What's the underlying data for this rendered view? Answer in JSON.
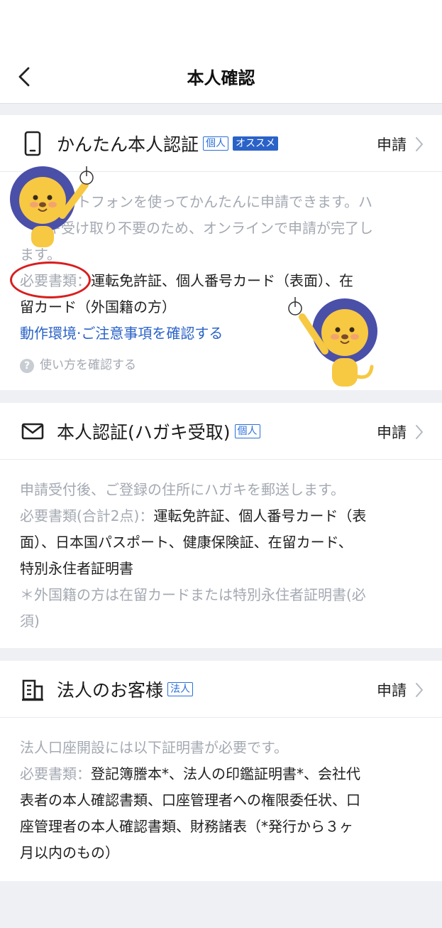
{
  "header": {
    "title": "本人確認"
  },
  "cards": {
    "easy": {
      "title": "かんたん本人認証",
      "badge_personal": "個人",
      "badge_recommend": "オススメ",
      "apply": "申請",
      "desc_line1": "ートフォンを使ってかんたんに申請できます。ハ",
      "desc_line2": "ガキ受け取り不要のため、オンラインで申請が完了し",
      "desc_line3": "ます。",
      "req_label": "必要書類：",
      "req_text1": "運転免許証、個人番号カード（表面）、在",
      "req_text2": "留カード（外国籍の方）",
      "link": "動作環境·ご注意事項を確認する",
      "howto": "使い方を確認する"
    },
    "postcard": {
      "title": "本人認証(ハガキ受取)",
      "badge_personal": "個人",
      "apply": "申請",
      "desc": "申請受付後、ご登録の住所にハガキを郵送します。",
      "req_label": "必要書類(合計2点)：",
      "req_text1": "運転免許証、個人番号カード（表",
      "req_text2": "面）、日本国パスポート、健康保険証、在留カード、",
      "req_text3": "特別永住者証明書",
      "note1": "＊外国籍の方は在留カードまたは特別永住者証明書(必",
      "note2": "須)"
    },
    "corporate": {
      "title": "法人のお客様",
      "badge_corp": "法人",
      "apply": "申請",
      "desc": "法人口座開設には以下証明書が必要です。",
      "req_label": "必要書類：",
      "req_text1": "登記簿謄本*、法人の印鑑証明書*、会社代",
      "req_text2": "表者の本人確認書類、口座管理者への権限委任状、口",
      "req_text3": "座管理者の本人確認書類、財務諸表（*発行から３ヶ",
      "req_text4": "月以内のもの）"
    }
  },
  "icons": {
    "back": "chevron-left-icon",
    "phone": "smartphone-icon",
    "mail": "envelope-icon",
    "building": "building-icon",
    "chevron": "chevron-right-icon",
    "help": "question-circle-icon",
    "mascot": "lion-mascot"
  },
  "colors": {
    "accent": "#2a62c8",
    "highlight": "#d81e1e",
    "muted": "#a4a9b2"
  }
}
